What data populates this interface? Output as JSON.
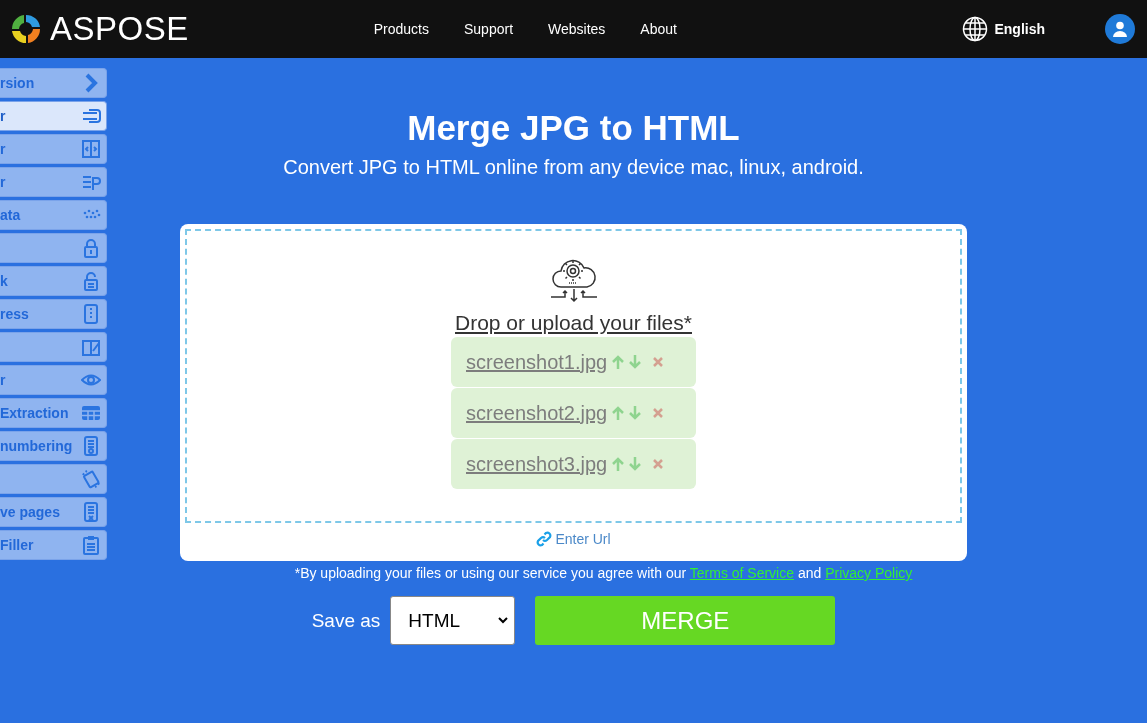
{
  "header": {
    "logo": "ASPOSE",
    "nav": [
      "Products",
      "Support",
      "Websites",
      "About"
    ],
    "language": "English"
  },
  "sidebar": {
    "items": [
      {
        "label": "rsion",
        "kind": "chevron",
        "selected": false
      },
      {
        "label": "r",
        "kind": "enter",
        "selected": true
      },
      {
        "label": "r",
        "kind": "split",
        "selected": false
      },
      {
        "label": "r",
        "kind": "paragraph",
        "selected": false
      },
      {
        "label": "ata",
        "kind": "dots",
        "selected": false
      },
      {
        "kind": "lock",
        "selected": false
      },
      {
        "label": "k",
        "kind": "unlock",
        "selected": false
      },
      {
        "label": "ress",
        "kind": "zip",
        "selected": false
      },
      {
        "kind": "edit",
        "selected": false
      },
      {
        "label": "r",
        "kind": "eye",
        "selected": false
      },
      {
        "label": "Extraction",
        "kind": "table",
        "selected": false
      },
      {
        "label": "numbering",
        "kind": "docnum",
        "selected": false
      },
      {
        "kind": "rotate",
        "selected": false
      },
      {
        "label": "ve pages",
        "kind": "docremove",
        "selected": false
      },
      {
        "label": "Filler",
        "kind": "clipboard",
        "selected": false
      }
    ]
  },
  "title": "Merge JPG to HTML",
  "subtitle": "Convert JPG to HTML online from any device mac, linux, android.",
  "upload": {
    "prompt": "Drop or upload your files*",
    "files": [
      "screenshot1.jpg",
      "screenshot2.jpg",
      "screenshot3.jpg"
    ],
    "url_link": "Enter Url"
  },
  "terms": {
    "text": "*By uploading your files or using our service you agree with our",
    "link1": "Terms of Service",
    "and": "and",
    "link2": "Privacy Policy"
  },
  "save": {
    "label": "Save as",
    "format": "HTML",
    "button": "MERGE"
  }
}
